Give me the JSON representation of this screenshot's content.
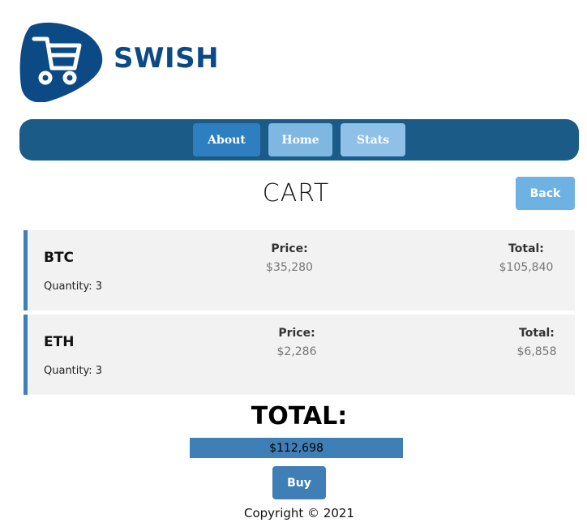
{
  "brand": {
    "name": "SWISH",
    "logo_icon": "shopping-cart-icon",
    "color": "#0c4a86"
  },
  "nav": {
    "items": [
      {
        "label": "About"
      },
      {
        "label": "Home"
      },
      {
        "label": "Stats"
      }
    ],
    "bar_color": "#1a5b87"
  },
  "page": {
    "title": "CART",
    "back_label": "Back"
  },
  "cart": {
    "items": [
      {
        "name": "BTC",
        "quantity": "Quantity: 3",
        "price_label": "Price:",
        "price": "$35,280",
        "total_label": "Total:",
        "total": "$105,840"
      },
      {
        "name": "ETH",
        "quantity": "Quantity: 3",
        "price_label": "Price:",
        "price": "$2,286",
        "total_label": "Total:",
        "total": "$6,858"
      }
    ]
  },
  "summary": {
    "heading": "TOTAL:",
    "amount": "$112,698",
    "buy_label": "Buy"
  },
  "footer": {
    "copyright": "Copyright © 2021"
  },
  "colors": {
    "accent": "#3f7fb6",
    "light_button": "#6eb1e3"
  }
}
